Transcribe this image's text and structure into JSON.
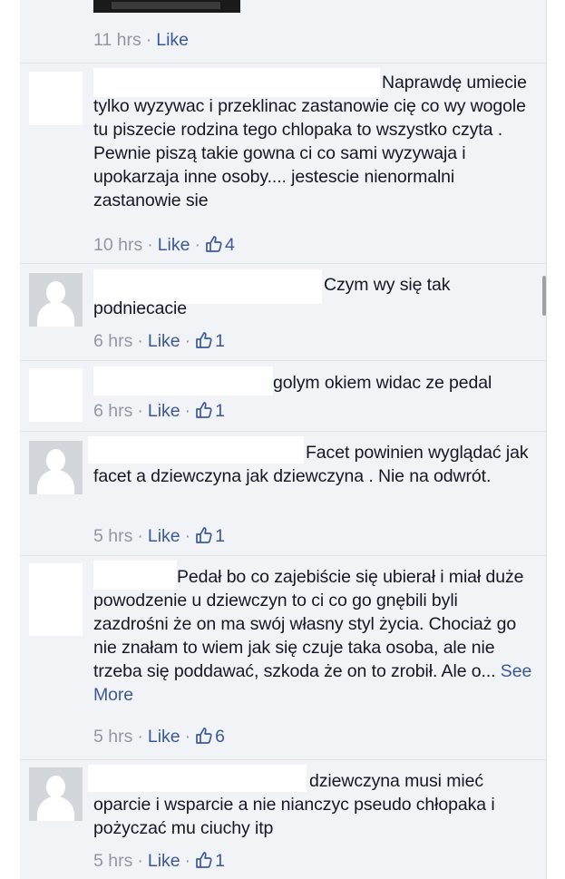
{
  "first_row": {
    "time": "11 hrs",
    "like": "Like"
  },
  "comments": [
    {
      "text": "Naprawdę umiecie tylko wyzywac i przeklinac zastanowie cię co wy wogole tu piszecie rodzina tego chlopaka to wszystko czyta . Pewnie piszą takie gowna ci co sami wyzywaja i upokarzaja inne osoby.... jestescie nienormalni zastanowie sie",
      "time": "10 hrs",
      "like": "Like",
      "likes": "4"
    },
    {
      "text": "Czym wy się tak podniecacie",
      "time": "6 hrs",
      "like": "Like",
      "likes": "1"
    },
    {
      "text": "golym okiem widac ze pedal",
      "time": "6 hrs",
      "like": "Like",
      "likes": "1"
    },
    {
      "text": "Facet powinien wyglądać jak facet a dziewczyna jak dziewczyna . Nie na odwrót.",
      "time": "5 hrs",
      "like": "Like",
      "likes": "1"
    },
    {
      "text": "Pedał bo co zajebiście się ubierał i miał duże powodzenie u dziewczyn to ci co go gnębili byli zazdrośni że on ma swój własny styl życia. Chociaż go nie znałam to wiem jak się czuje taka osoba, ale nie trzeba się poddawać, szkoda że on to zrobił. Ale o...",
      "see_more": "See More",
      "time": "5 hrs",
      "like": "Like",
      "likes": "6"
    },
    {
      "text": "dziewczyna musi mieć oparcie i wsparcie a nie nianczyc pseudo chłopaka i pożyczać mu ciuchy itp",
      "time": "5 hrs",
      "like": "Like",
      "likes": "1"
    }
  ],
  "icons": {
    "like_count": "thumbs-up-icon",
    "default_avatar": "silhouette-icon"
  },
  "colors": {
    "link": "#3b5998",
    "meta": "#9197a3",
    "text": "#141823",
    "background": "#f2f3f7"
  }
}
